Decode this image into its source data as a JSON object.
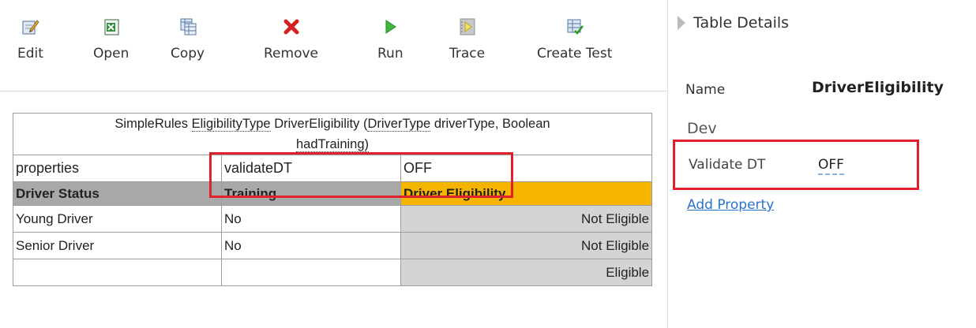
{
  "toolbar": {
    "buttons": [
      {
        "id": "edit",
        "label": "Edit",
        "icon": "edit-icon"
      },
      {
        "id": "open",
        "label": "Open",
        "icon": "excel-icon"
      },
      {
        "id": "copy",
        "label": "Copy",
        "icon": "copy-table-icon"
      },
      {
        "id": "remove",
        "label": "Remove",
        "icon": "remove-x-icon"
      },
      {
        "id": "run",
        "label": "Run",
        "icon": "run-play-icon"
      },
      {
        "id": "trace",
        "label": "Trace",
        "icon": "trace-icon"
      },
      {
        "id": "create_test",
        "label": "Create Test",
        "icon": "create-test-icon"
      }
    ]
  },
  "rule_table": {
    "signature": {
      "p1": "SimpleRules ",
      "return_type": "EligibilityType",
      "p2": " DriverEligibility (",
      "param_type": "DriverType",
      "p3": " driverType, Boolean ",
      "p4": "hadTraining)"
    },
    "properties": {
      "label": "properties",
      "key": "validateDT",
      "value": "OFF"
    },
    "headers": [
      "Driver Status",
      "Training",
      "Driver Eligibility"
    ],
    "rows": [
      [
        "Young Driver",
        "No",
        "Not Eligible"
      ],
      [
        "Senior Driver",
        "No",
        "Not Eligible"
      ],
      [
        "",
        "",
        "Eligible"
      ]
    ]
  },
  "details": {
    "title": "Table Details",
    "name_label": "Name",
    "name_value": "DriverEligibility",
    "section": "Dev",
    "property_label": "Validate DT",
    "property_value": "OFF",
    "add_property": "Add Property"
  },
  "colors": {
    "highlight": "#e0202a",
    "condition_header": "#a8a8a8",
    "action_header": "#f4b400",
    "action_cell": "#d4d4d4",
    "link": "#2a72c9"
  }
}
